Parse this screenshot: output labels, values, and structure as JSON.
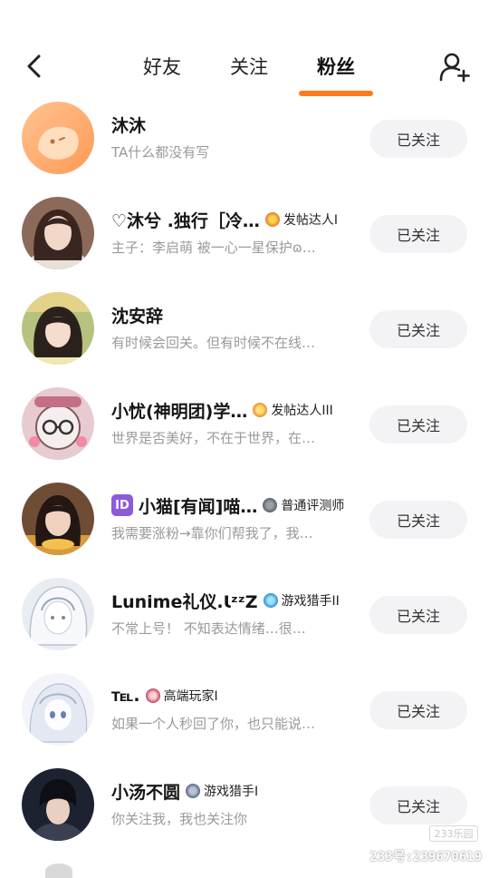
{
  "header": {
    "tabs": [
      {
        "label": "好友",
        "active": false
      },
      {
        "label": "关注",
        "active": false
      },
      {
        "label": "粉丝",
        "active": true
      }
    ],
    "accent_color": "#ff7a1a"
  },
  "followers": [
    {
      "name": "沐沐",
      "badge": "",
      "subtitle": "TA什么都没有写",
      "button": "已关注",
      "avatar_color": "#ffb27a"
    },
    {
      "name": "♡沐兮 .独行［冷…",
      "badge": "发帖达人I",
      "subtitle": "主子：李启萌 被一心一星保护ɷ…",
      "button": "已关注",
      "avatar_color": "#6b4a3e"
    },
    {
      "name": "沈安辞",
      "badge": "",
      "subtitle": "有时候会回关。但有时候不在线…",
      "button": "已关注",
      "avatar_color": "#9b8a63"
    },
    {
      "name": "小忧(神明团)学…",
      "badge": "发帖达人III",
      "subtitle": "世界是否美好，不在于世界，在…",
      "button": "已关注",
      "avatar_color": "#c9a7a5"
    },
    {
      "name": "小猫[有闻]喵…",
      "badge": "普通评测师",
      "subtitle": "我需要涨粉→靠你们帮我了，我…",
      "button": "已关注",
      "avatar_color": "#7a5a43",
      "id_tag": "ID"
    },
    {
      "name": "Lunime礼仪.ꙆᶻᶻZ",
      "badge": "游戏猎手II",
      "subtitle": "不常上号！   不知表达情绪…很…",
      "button": "已关注",
      "avatar_color": "#cfd6e0"
    },
    {
      "name": "℡.",
      "badge": "高端玩家I",
      "subtitle": "如果一个人秒回了你，也只能说…",
      "button": "已关注",
      "avatar_color": "#dde2ee"
    },
    {
      "name": "小汤不圆",
      "badge": "游戏猎手I",
      "subtitle": "你关注我，我也关注你",
      "button": "已关注",
      "avatar_color": "#2a2f3a"
    }
  ],
  "watermark": {
    "logo": "233乐园",
    "id": "233号:239670619"
  }
}
